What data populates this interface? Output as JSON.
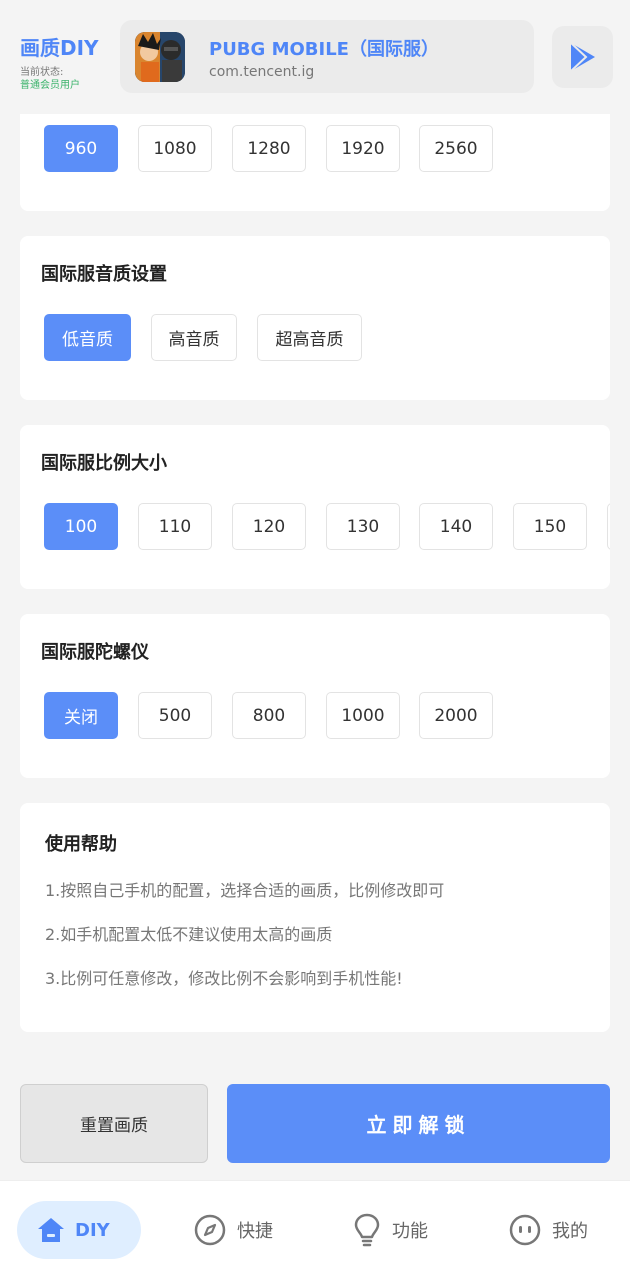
{
  "header": {
    "brand_title": "画质DIY",
    "status_label": "当前状态:",
    "member_status": "普通会员用户",
    "app_name": "PUBG MOBILE（国际服）",
    "app_package": "com.tencent.ig",
    "app_icon": "game-icon",
    "launch_icon": "play-store-icon"
  },
  "resolution": {
    "options": [
      "960",
      "1080",
      "1280",
      "1920",
      "2560"
    ],
    "selected": "960"
  },
  "audio": {
    "title": "国际服音质设置",
    "options": [
      "低音质",
      "高音质",
      "超高音质"
    ],
    "selected": "低音质"
  },
  "ratio": {
    "title": "国际服比例大小",
    "options": [
      "100",
      "110",
      "120",
      "130",
      "140",
      "150"
    ],
    "selected": "100"
  },
  "gyro": {
    "title": "国际服陀螺仪",
    "options": [
      "关闭",
      "500",
      "800",
      "1000",
      "2000"
    ],
    "selected": "关闭"
  },
  "help": {
    "title": "使用帮助",
    "lines": [
      "1.按照自己手机的配置，选择合适的画质，比例修改即可",
      "2.如手机配置太低不建议使用太高的画质",
      "3.比例可任意修改，修改比例不会影响到手机性能!"
    ]
  },
  "actions": {
    "reset_label": "重置画质",
    "unlock_label": "立即解锁"
  },
  "nav": {
    "items": [
      {
        "label": "DIY",
        "icon": "home-icon"
      },
      {
        "label": "快捷",
        "icon": "compass-icon"
      },
      {
        "label": "功能",
        "icon": "lightbulb-icon"
      },
      {
        "label": "我的",
        "icon": "face-icon"
      }
    ],
    "active": "DIY"
  },
  "colors": {
    "accent": "#5b8ef8",
    "brand": "#4f86f7",
    "member_green": "#3bb36b",
    "nav_active_bg": "#dfeeff"
  }
}
